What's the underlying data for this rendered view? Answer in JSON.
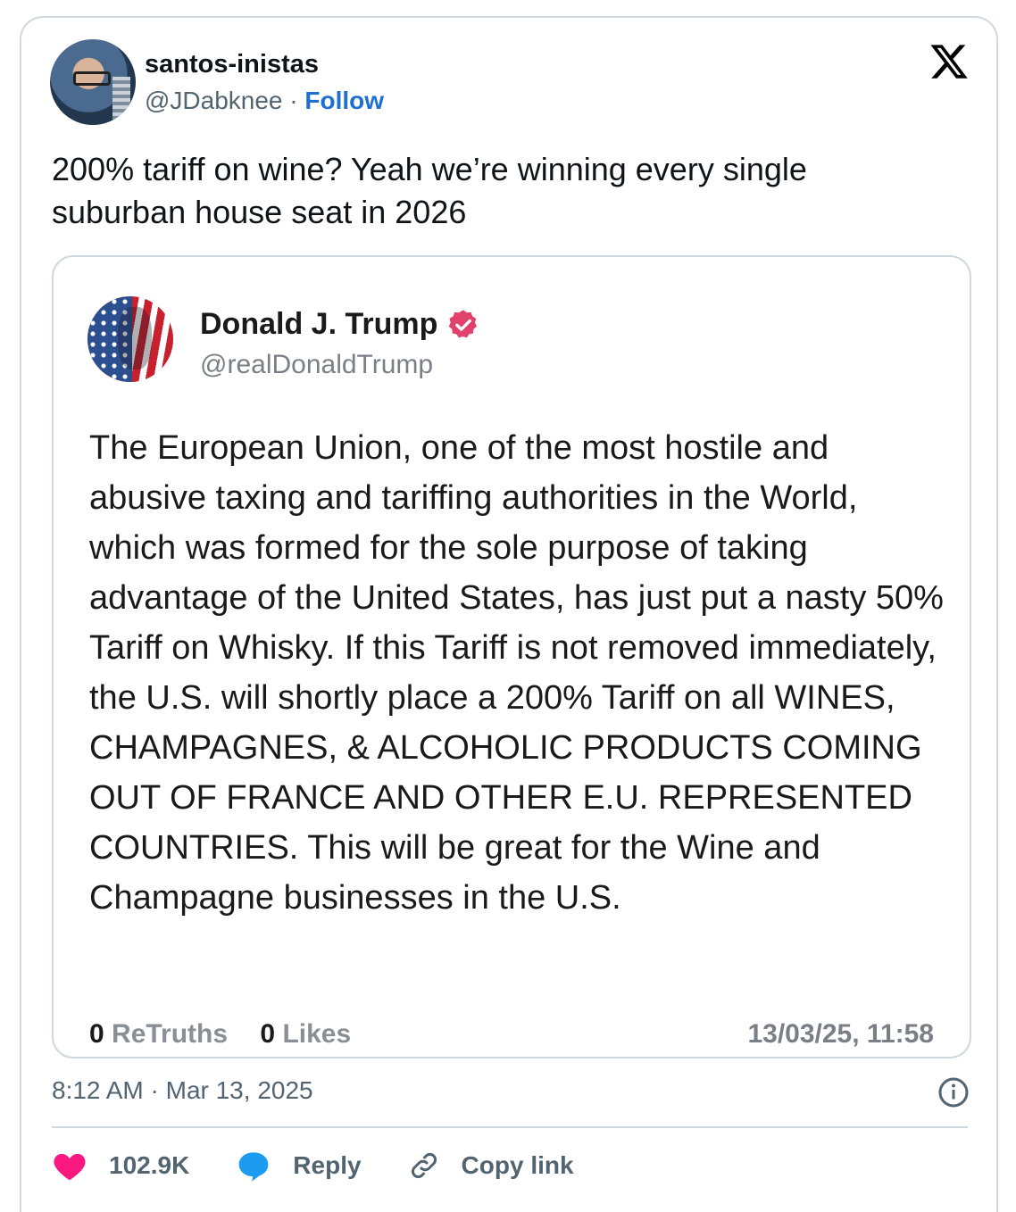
{
  "author": {
    "name": "santos-inistas",
    "handle": "@JDabknee",
    "separator": "·",
    "follow_label": "Follow"
  },
  "tweet": {
    "text": "200% tariff on wine? Yeah we’re winning every single suburban house seat in 2026"
  },
  "quoted": {
    "name": "Donald J. Trump",
    "handle": "@realDonaldTrump",
    "verified": true,
    "verified_color": "#e1416b",
    "body": "The European Union, one of the most hostile and abusive taxing and tariffing authorities in the World, which was formed for the sole purpose of taking advantage of the United States, has just put a nasty 50% Tariff on Whisky. If this Tariff is not removed immediately, the U.S. will shortly place a 200% Tariff on all WINES, CHAMPAGNES, & ALCOHOLIC PRODUCTS COMING OUT OF FRANCE AND OTHER E.U. REPRESENTED COUNTRIES. This will be great for the Wine and Champagne businesses in the U.S.",
    "retruths_count": "0",
    "retruths_label": "ReTruths",
    "likes_count": "0",
    "likes_label": "Likes",
    "date": "13/03/25, 11:58"
  },
  "meta": {
    "timestamp": "8:12 AM · Mar 13, 2025"
  },
  "actions": {
    "likes": "102.9K",
    "reply_label": "Reply",
    "copy_label": "Copy link"
  },
  "colors": {
    "follow": "#1d6fd1",
    "heart": "#f91880",
    "reply_bubble": "#1d9bf0",
    "border": "#cfd9de"
  },
  "icons": [
    "x-logo-icon",
    "verified-badge-icon",
    "info-icon",
    "heart-icon",
    "reply-icon",
    "link-icon"
  ]
}
